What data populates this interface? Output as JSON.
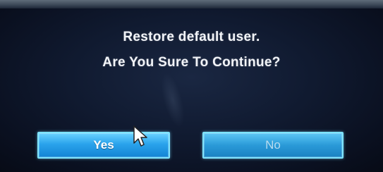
{
  "dialog": {
    "line1": "Restore default user.",
    "line2": "Are You Sure To Continue?",
    "yes_label": "Yes",
    "no_label": "No"
  },
  "colors": {
    "background": "#101a30",
    "button_border": "#7ee4ff",
    "button_fill": "#1e94e0",
    "text": "#f2f4f8"
  },
  "icons": {
    "pointer": "mouse-pointer-icon"
  }
}
